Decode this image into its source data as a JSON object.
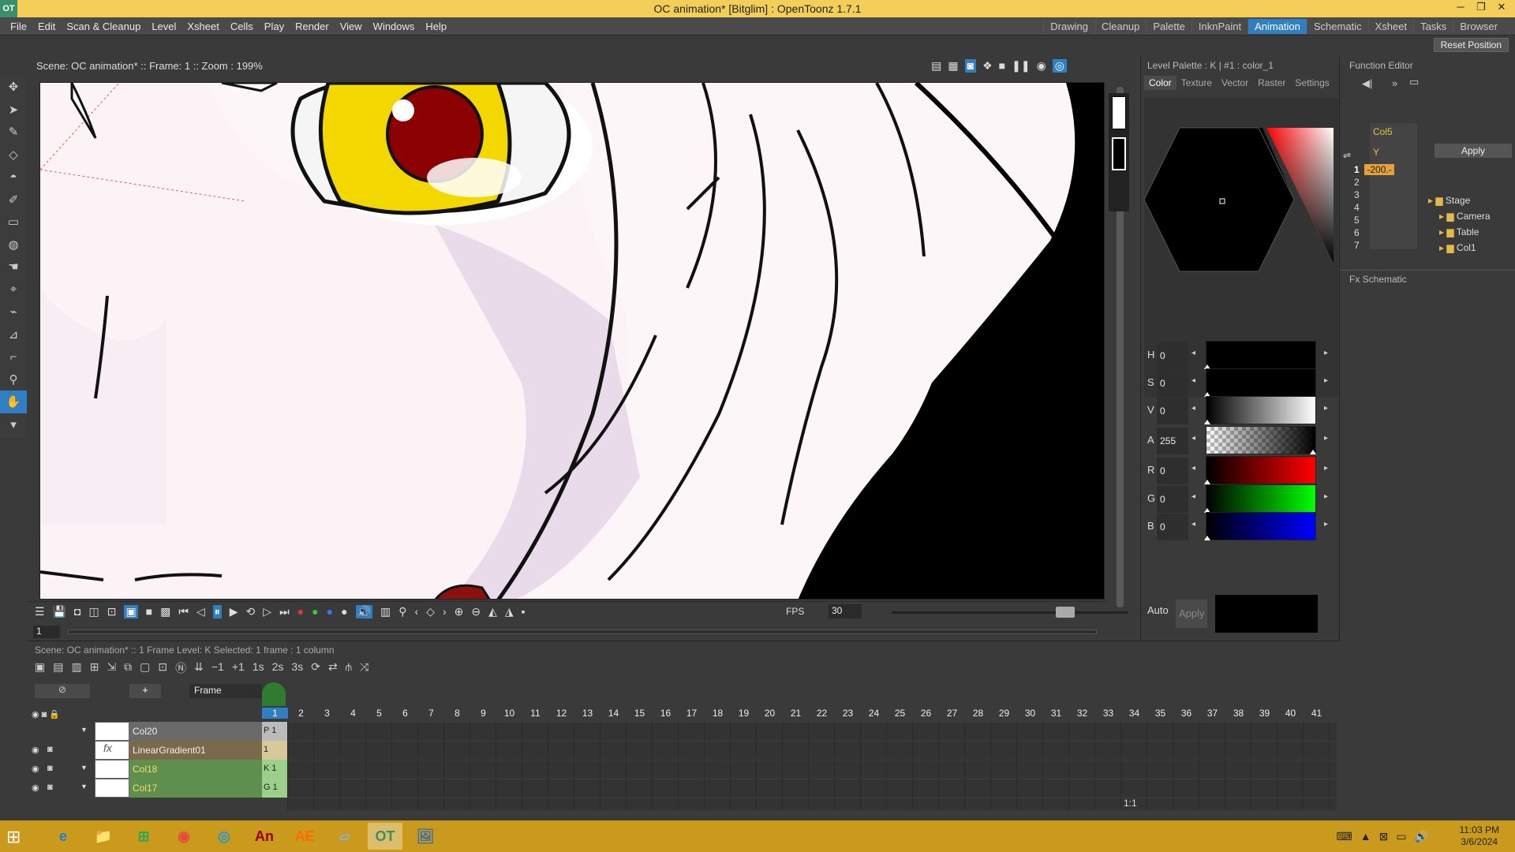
{
  "window": {
    "title": "OC animation* [Bitglim] : OpenToonz 1.7.1",
    "logo": "OT",
    "minimize": "─",
    "restore": "❐",
    "close": "✕"
  },
  "menu": {
    "items": [
      "File",
      "Edit",
      "Scan & Cleanup",
      "Level",
      "Xsheet",
      "Cells",
      "Play",
      "Render",
      "View",
      "Windows",
      "Help"
    ],
    "rooms": [
      "Drawing",
      "Cleanup",
      "Palette",
      "InknPaint",
      "Animation",
      "Schematic",
      "Xsheet",
      "Tasks",
      "Browser"
    ],
    "active_room": "Animation",
    "reset_position": "Reset Position"
  },
  "viewer": {
    "status": "Scene: OC animation*  ::  Frame: 1  ::  Zoom : 199%",
    "fps_label": "FPS",
    "fps_value": "30",
    "frame_field": "1"
  },
  "palette_panel": {
    "header": "Level Palette : K | #1 : color_1",
    "tabs": [
      "Color",
      "Texture",
      "Vector",
      "Raster",
      "Settings"
    ],
    "active_tab": "Color",
    "channels": [
      {
        "label": "H",
        "value": "0"
      },
      {
        "label": "S",
        "value": "0"
      },
      {
        "label": "V",
        "value": "0"
      },
      {
        "label": "A",
        "value": "255"
      },
      {
        "label": "R",
        "value": "0"
      },
      {
        "label": "G",
        "value": "0"
      },
      {
        "label": "B",
        "value": "0"
      }
    ],
    "auto_label": "Auto",
    "apply_label": "Apply"
  },
  "function_editor": {
    "header": "Function Editor",
    "column_header": "Col5",
    "channel": "Y",
    "rows": [
      "1",
      "2",
      "3",
      "4",
      "5",
      "6",
      "7"
    ],
    "first_value": "-200.-",
    "apply_label": "Apply",
    "tree": [
      "Stage",
      "Camera",
      "Table",
      "Col1"
    ]
  },
  "fx_schematic": {
    "header": "Fx Schematic"
  },
  "xsheet": {
    "status": "Scene: OC animation*  ::  1 Frame  Level: K   Selected: 1 frame : 1 column",
    "frame_mode": "Frame",
    "frame_numbers": [
      "1",
      "2",
      "3",
      "4",
      "5",
      "6",
      "7",
      "8",
      "9",
      "10",
      "11",
      "12",
      "13",
      "14",
      "15",
      "16",
      "17",
      "18",
      "19",
      "20",
      "21",
      "22",
      "23",
      "24",
      "25",
      "26",
      "27",
      "28",
      "29",
      "30",
      "31",
      "32",
      "33",
      "34",
      "35",
      "36",
      "37",
      "38",
      "39",
      "40",
      "41"
    ],
    "layers": [
      {
        "name": "Col20",
        "cell": "P  1",
        "color": "#6a6a6a"
      },
      {
        "name": "LinearGradient01",
        "cell": "1",
        "color": "#7a6a4a"
      },
      {
        "name": "Col18",
        "cell": "K  1",
        "color": "#5f8f4f"
      },
      {
        "name": "Col17",
        "cell": "G 1",
        "color": "#5f8f4f"
      }
    ],
    "zoom_label": "1:1"
  },
  "taskbar": {
    "time": "11:03 PM",
    "date": "3/6/2024",
    "apps": [
      "e",
      "📁",
      "⊞",
      "◉",
      "◎",
      "An",
      "AE",
      "▱",
      "OT",
      "🖼"
    ]
  },
  "colors": {
    "accent": "#2f7fc2",
    "title_bar": "#f3cf5a",
    "taskbar": "#c99a1c"
  }
}
